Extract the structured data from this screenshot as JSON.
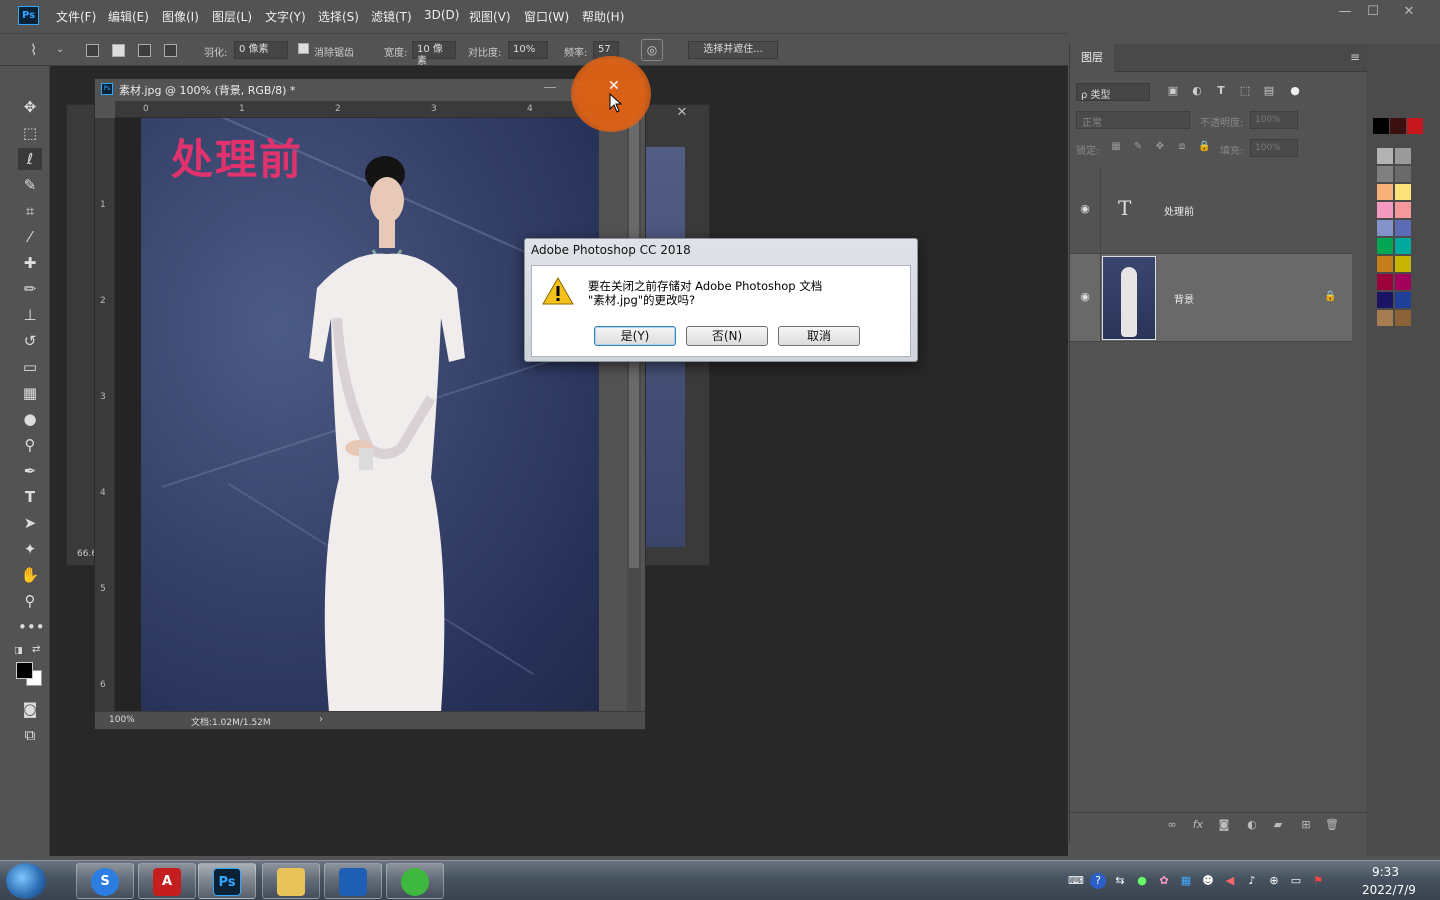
{
  "app": {
    "logo_text": "Ps"
  },
  "menu": [
    "文件(F)",
    "编辑(E)",
    "图像(I)",
    "图层(L)",
    "文字(Y)",
    "选择(S)",
    "滤镜(T)",
    "3D(D)",
    "视图(V)",
    "窗口(W)",
    "帮助(H)"
  ],
  "window_controls": {
    "minimize": "—",
    "maximize": "☐",
    "close": "✕"
  },
  "options": {
    "feather_label": "羽化:",
    "feather_value": "0 像素",
    "antialias_label": "消除锯齿",
    "width_label": "宽度:",
    "width_value": "10 像素",
    "contrast_label": "对比度:",
    "contrast_value": "10%",
    "frequency_label": "频率:",
    "frequency_value": "57",
    "select_mask_label": "选择并遮住..."
  },
  "document": {
    "title": "素材.jpg @ 100% (背景, RGB/8) *",
    "canvas_text": "处理前",
    "zoom": "100%",
    "doc_info": "文档:1.02M/1.52M",
    "ruler_h": [
      "0",
      "1",
      "2",
      "3",
      "4"
    ],
    "ruler_v": [
      "1",
      "2",
      "3",
      "4",
      "5",
      "6"
    ],
    "close_symbol": "✕"
  },
  "background_doc": {
    "zoom": "66.6"
  },
  "dialog": {
    "title": "Adobe Photoshop CC 2018",
    "message_line1": "要在关闭之前存储对 Adobe Photoshop 文档",
    "message_line2": "\"素材.jpg\"的更改吗?",
    "yes": "是(Y)",
    "no": "否(N)",
    "cancel": "取消"
  },
  "layers_panel": {
    "tab": "图层",
    "filter": "ρ 类型",
    "blend_mode": "正常",
    "opacity_label": "不透明度:",
    "opacity_value": "100%",
    "lock_label": "锁定:",
    "fill_label": "填充:",
    "fill_value": "100%",
    "layers": [
      {
        "name": "处理前",
        "type": "text",
        "thumb": "T"
      },
      {
        "name": "背景",
        "type": "image",
        "locked": true
      }
    ]
  },
  "swatches": [
    "#000000",
    "#3d1010",
    "#c4161c",
    "#b3b3b3",
    "#9a9a9a",
    "#808080",
    "#6a6a6a",
    "#f9b17a",
    "#fbe27b",
    "#f49ac1",
    "#f5989d",
    "#8393ca",
    "#5c6bb3",
    "#00a651",
    "#00a99d",
    "#c37e19",
    "#c6b500",
    "#9e0039",
    "#a2005b",
    "#1b1464",
    "#21409a",
    "#a67c52",
    "#8c6239"
  ],
  "taskbar": {
    "apps": [
      "S",
      "A",
      "Ps",
      "folder",
      "chart",
      "wechat"
    ],
    "time": "9:33",
    "date": "2022/7/9"
  }
}
